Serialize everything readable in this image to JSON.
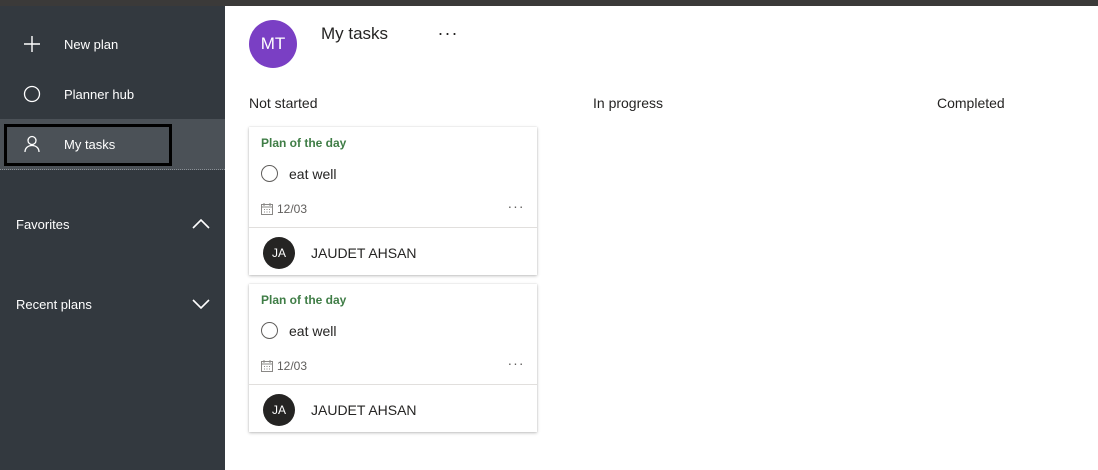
{
  "sidebar": {
    "items": [
      {
        "label": "New plan",
        "icon": "plus-icon"
      },
      {
        "label": "Planner hub",
        "icon": "circle-icon"
      },
      {
        "label": "My tasks",
        "icon": "person-icon",
        "active": true
      }
    ],
    "sections": [
      {
        "label": "Favorites",
        "icon": "chevron-up-icon",
        "expanded": true
      },
      {
        "label": "Recent plans",
        "icon": "chevron-down-icon",
        "expanded": false
      }
    ]
  },
  "header": {
    "avatar_initials": "MT",
    "title": "My tasks",
    "more_label": "···"
  },
  "columns": [
    {
      "label": "Not started"
    },
    {
      "label": "In progress"
    },
    {
      "label": "Completed"
    }
  ],
  "tasks": [
    {
      "plan": "Plan of the day",
      "title": "eat well",
      "due": "12/03",
      "more": "···",
      "assignee_initials": "JA",
      "assignee": "JAUDET AHSAN"
    },
    {
      "plan": "Plan of the day",
      "title": "eat well",
      "due": "12/03",
      "more": "···",
      "assignee_initials": "JA",
      "assignee": "JAUDET AHSAN"
    }
  ],
  "colors": {
    "sidebar_bg": "#33393f",
    "sidebar_active": "#4b5157",
    "avatar_mt": "#7a3fc4",
    "plan_label": "#3f7d46",
    "avatar_ja": "#252423"
  }
}
